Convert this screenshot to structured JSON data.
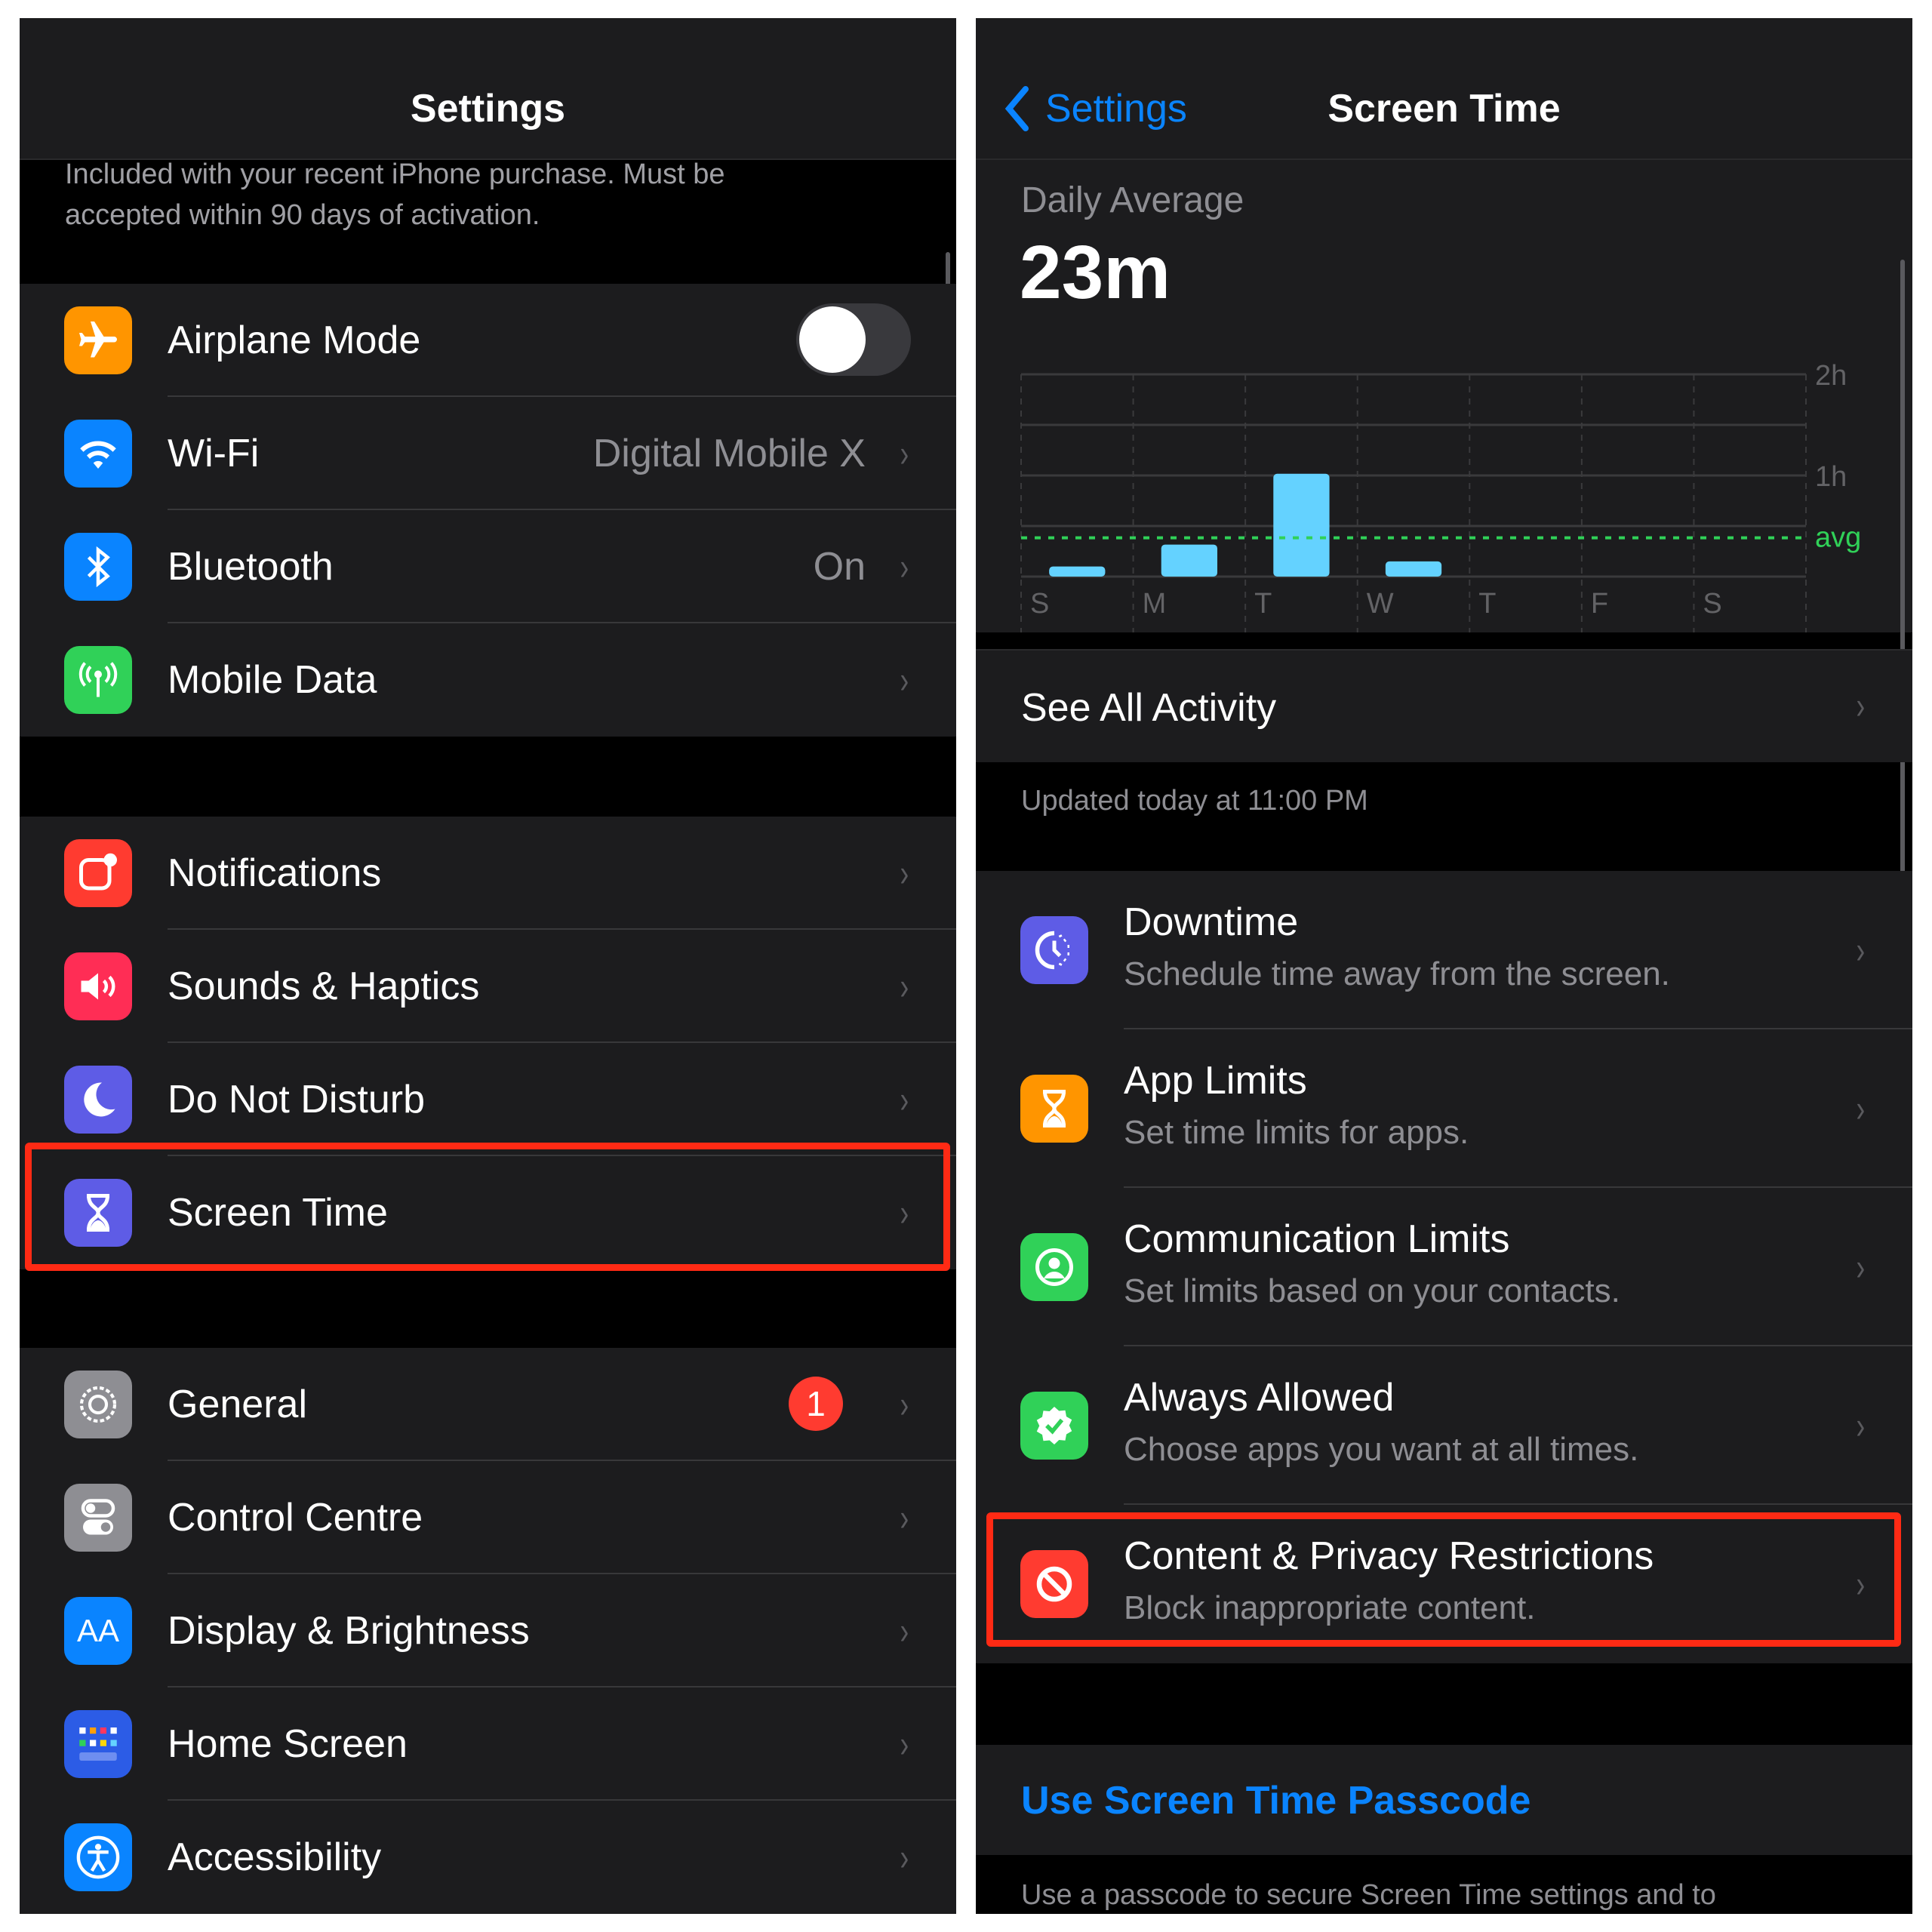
{
  "left": {
    "nav_title": "Settings",
    "promo_text": [
      "Included with your recent iPhone purchase. Must be",
      "accepted within 90 days of activation."
    ],
    "group1": [
      {
        "label": "Airplane Mode",
        "icon": "airplane-icon",
        "color": "#ff9500",
        "toggle": false
      },
      {
        "label": "Wi-Fi",
        "icon": "wifi-icon",
        "color": "#0a84ff",
        "value": "Digital Mobile X"
      },
      {
        "label": "Bluetooth",
        "icon": "bluetooth-icon",
        "color": "#0a84ff",
        "value": "On"
      },
      {
        "label": "Mobile Data",
        "icon": "antenna-icon",
        "color": "#30d158"
      }
    ],
    "group2": [
      {
        "label": "Notifications",
        "icon": "notifications-icon",
        "color": "#ff3b30"
      },
      {
        "label": "Sounds & Haptics",
        "icon": "speaker-icon",
        "color": "#ff2d55"
      },
      {
        "label": "Do Not Disturb",
        "icon": "moon-icon",
        "color": "#5e5ce6"
      },
      {
        "label": "Screen Time",
        "icon": "hourglass-icon",
        "color": "#5e5ce6",
        "highlighted": true
      }
    ],
    "group3": [
      {
        "label": "General",
        "icon": "gear-icon",
        "color": "#8e8e93",
        "badge": "1"
      },
      {
        "label": "Control Centre",
        "icon": "switches-icon",
        "color": "#8e8e93"
      },
      {
        "label": "Display & Brightness",
        "icon": "text-size-icon",
        "color": "#0a84ff",
        "glyph": "AA"
      },
      {
        "label": "Home Screen",
        "icon": "home-grid-icon",
        "color": "#2c5ce6"
      },
      {
        "label": "Accessibility",
        "icon": "accessibility-icon",
        "color": "#0a84ff"
      }
    ]
  },
  "right": {
    "back_label": "Settings",
    "nav_title": "Screen Time",
    "daily_average_label": "Daily Average",
    "daily_average_value": "23m",
    "see_all": "See All Activity",
    "updated": "Updated today at 11:00 PM",
    "items": [
      {
        "title": "Downtime",
        "subtitle": "Schedule time away from the screen.",
        "icon": "downtime-icon",
        "color": "#5e5ce6"
      },
      {
        "title": "App Limits",
        "subtitle": "Set time limits for apps.",
        "icon": "hourglass-icon",
        "color": "#ff9500"
      },
      {
        "title": "Communication Limits",
        "subtitle": "Set limits based on your contacts.",
        "icon": "contact-icon",
        "color": "#30d158"
      },
      {
        "title": "Always Allowed",
        "subtitle": "Choose apps you want at all times.",
        "icon": "checkmark-badge-icon",
        "color": "#30d158"
      },
      {
        "title": "Content & Privacy Restrictions",
        "subtitle": "Block inappropriate content.",
        "icon": "restricted-icon",
        "color": "#ff3b30",
        "highlighted": true
      }
    ],
    "passcode_link": "Use Screen Time Passcode",
    "passcode_footer": "Use a passcode to secure Screen Time settings and to"
  },
  "chart_data": {
    "type": "bar",
    "title": "Daily Average",
    "categories": [
      "S",
      "M",
      "T",
      "W",
      "T",
      "F",
      "S"
    ],
    "values_minutes": [
      6,
      19,
      61,
      9,
      0,
      0,
      0
    ],
    "average_minutes": 23,
    "average_label": "avg",
    "y_ticks": [
      "2h",
      "1h"
    ],
    "ylim_minutes": [
      0,
      120
    ],
    "grid": true,
    "bar_color": "#64d2ff",
    "avg_color": "#30d158"
  },
  "colors": {
    "highlight": "#ff2a14",
    "link": "#0a84ff"
  }
}
